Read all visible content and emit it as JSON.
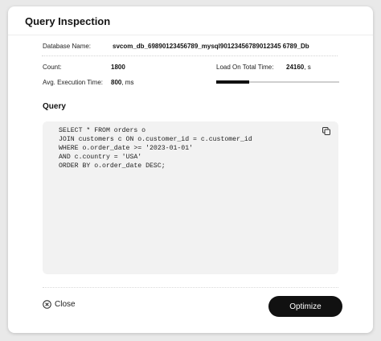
{
  "dialog": {
    "title": "Query Inspection",
    "database": {
      "label": "Database Name:",
      "value": "svcom_db_69890123456789_mysql90123456789012345 6789_Db"
    },
    "count": {
      "label": "Count:",
      "value": "1800"
    },
    "load_total": {
      "label": "Load On Total Time:",
      "value": "24160",
      "unit": ", s",
      "fraction": 0.27
    },
    "avg_exec": {
      "label": "Avg. Execution Time:",
      "value": "800",
      "unit": ", ms"
    },
    "query": {
      "heading": "Query",
      "text": "SELECT * FROM orders o\nJOIN customers c ON o.customer_id = c.customer_id\nWHERE o.order_date >= '2023-01-01'\nAND c.country = 'USA'\nORDER BY o.order_date DESC;",
      "copy_icon": "copy-icon"
    },
    "close_label": "Close",
    "close_icon": "close-circle-icon",
    "optimize_label": "Optimize"
  },
  "colors": {
    "primary_button": "#111111",
    "code_background": "#f2f2f2",
    "progress_fill": "#111111",
    "progress_track": "#cfcfcf"
  }
}
